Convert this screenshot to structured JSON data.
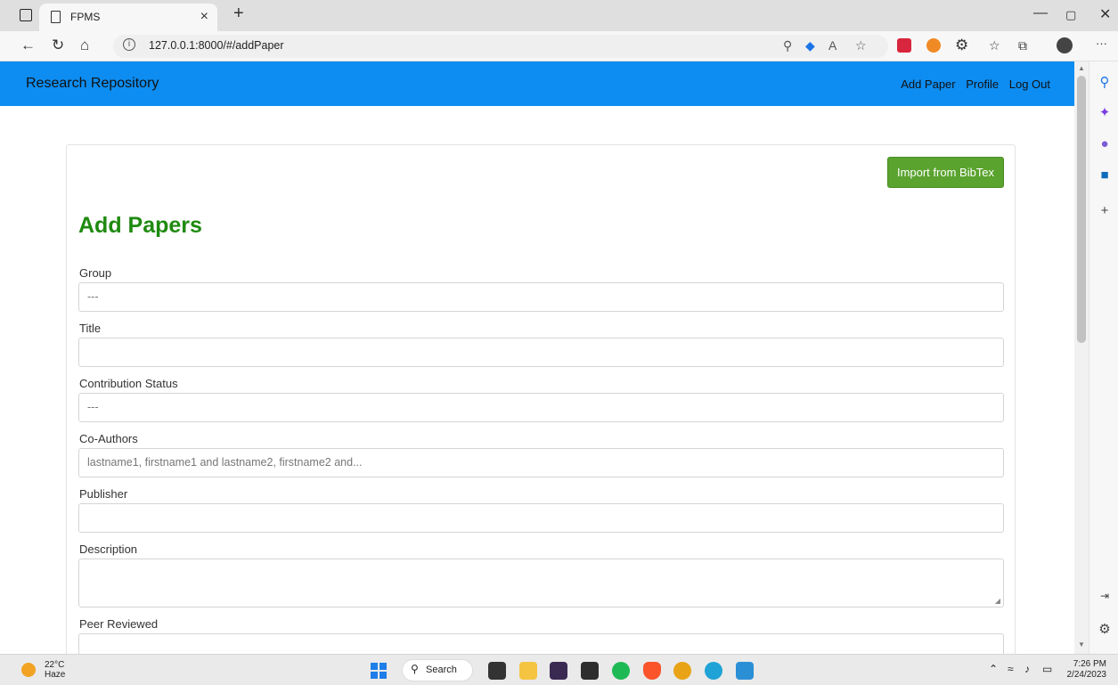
{
  "browser": {
    "tab_title": "FPMS",
    "tab_close": "×",
    "new_tab": "+",
    "url": "127.0.0.1:8000/#/addPaper",
    "more": "···"
  },
  "navbar": {
    "brand": "Research Repository",
    "links": [
      "Add Paper",
      "Profile",
      "Log Out"
    ]
  },
  "form": {
    "import_button": "Import from BibTex",
    "heading": "Add Papers",
    "fields": [
      {
        "label": "Group",
        "value": "---"
      },
      {
        "label": "Title",
        "value": ""
      },
      {
        "label": "Contribution Status",
        "value": "---"
      },
      {
        "label": "Co-Authors",
        "placeholder": "lastname1, firstname1 and lastname2, firstname2 and..."
      },
      {
        "label": "Publisher",
        "value": ""
      },
      {
        "label": "Description",
        "value": ""
      },
      {
        "label": "Peer Reviewed",
        "value": ""
      }
    ]
  },
  "taskbar": {
    "temperature": "22°C",
    "weather": "Haze",
    "search_label": "Search",
    "time": "7:26 PM",
    "date": "2/24/2023"
  }
}
